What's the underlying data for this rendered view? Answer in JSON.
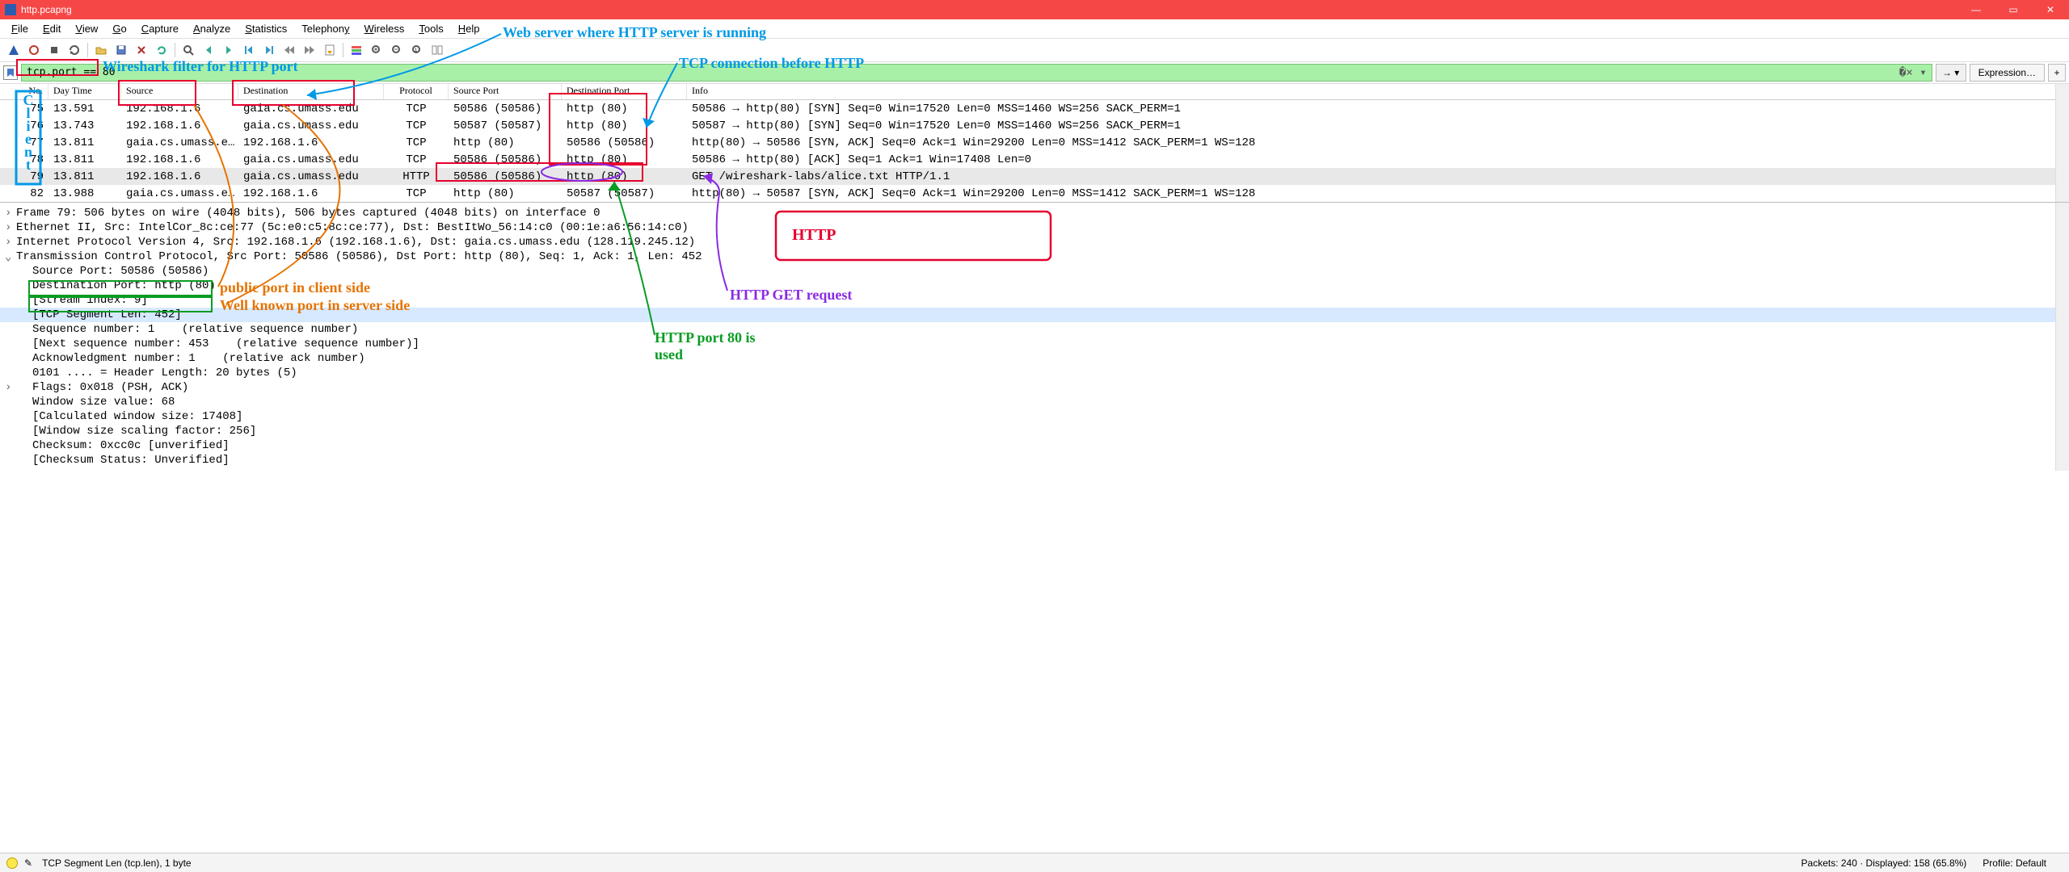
{
  "window": {
    "title": "http.pcapng"
  },
  "menus": [
    "File",
    "Edit",
    "View",
    "Go",
    "Capture",
    "Analyze",
    "Statistics",
    "Telephony",
    "Wireless",
    "Tools",
    "Help"
  ],
  "filter": {
    "value": "tcp.port == 80",
    "expression_label": "Expression…"
  },
  "columns": [
    "No.",
    "Day Time",
    "Source",
    "Destination",
    "Protocol",
    "Source Port",
    "Destination Port",
    "Info"
  ],
  "packets": [
    {
      "no": "75",
      "time": "13.591",
      "src": "192.168.1.6",
      "dst": "gaia.cs.umass.edu",
      "prot": "TCP",
      "sprt": "50586 (50586)",
      "dprt": "http (80)",
      "info": "50586 → http(80) [SYN] Seq=0 Win=17520 Len=0 MSS=1460 WS=256 SACK_PERM=1"
    },
    {
      "no": "76",
      "time": "13.743",
      "src": "192.168.1.6",
      "dst": "gaia.cs.umass.edu",
      "prot": "TCP",
      "sprt": "50587 (50587)",
      "dprt": "http (80)",
      "info": "50587 → http(80) [SYN] Seq=0 Win=17520 Len=0 MSS=1460 WS=256 SACK_PERM=1"
    },
    {
      "no": "77",
      "time": "13.811",
      "src": "gaia.cs.umass.e…",
      "dst": "192.168.1.6",
      "prot": "TCP",
      "sprt": "http (80)",
      "dprt": "50586 (50586)",
      "info": "http(80) → 50586 [SYN, ACK] Seq=0 Ack=1 Win=29200 Len=0 MSS=1412 SACK_PERM=1 WS=128"
    },
    {
      "no": "78",
      "time": "13.811",
      "src": "192.168.1.6",
      "dst": "gaia.cs.umass.edu",
      "prot": "TCP",
      "sprt": "50586 (50586)",
      "dprt": "http (80)",
      "info": "50586 → http(80) [ACK] Seq=1 Ack=1 Win=17408 Len=0"
    },
    {
      "no": "79",
      "time": "13.811",
      "src": "192.168.1.6",
      "dst": "gaia.cs.umass.edu",
      "prot": "HTTP",
      "sprt": "50586 (50586)",
      "dprt": "http (80)",
      "info": "GET /wireshark-labs/alice.txt HTTP/1.1",
      "sel": true
    },
    {
      "no": "82",
      "time": "13.988",
      "src": "gaia.cs.umass.e…",
      "dst": "192.168.1.6",
      "prot": "TCP",
      "sprt": "http (80)",
      "dprt": "50587 (50587)",
      "info": "http(80) → 50587 [SYN, ACK] Seq=0 Ack=1 Win=29200 Len=0 MSS=1412 SACK_PERM=1 WS=128"
    }
  ],
  "details": {
    "frame": "Frame 79: 506 bytes on wire (4048 bits), 506 bytes captured (4048 bits) on interface 0",
    "eth": "Ethernet II, Src: IntelCor_8c:ce:77 (5c:e0:c5:8c:ce:77), Dst: BestItWo_56:14:c0 (00:1e:a6:56:14:c0)",
    "ip": "Internet Protocol Version 4, Src: 192.168.1.6 (192.168.1.6), Dst: gaia.cs.umass.edu (128.119.245.12)",
    "tcp": "Transmission Control Protocol, Src Port: 50586 (50586), Dst Port: http (80), Seq: 1, Ack: 1, Len: 452",
    "srcport": "Source Port: 50586 (50586)",
    "dstport": "Destination Port: http (80)",
    "stream": "[Stream index: 9]",
    "seglen": "[TCP Segment Len: 452]",
    "seqnum": "Sequence number: 1    (relative sequence number)",
    "nextseq": "[Next sequence number: 453    (relative sequence number)]",
    "acknum": "Acknowledgment number: 1    (relative ack number)",
    "hdrlen": "0101 .... = Header Length: 20 bytes (5)",
    "flags": "Flags: 0x018 (PSH, ACK)",
    "winsize": "Window size value: 68",
    "calcwin": "[Calculated window size: 17408]",
    "winscale": "[Window size scaling factor: 256]",
    "cksum": "Checksum: 0xcc0c [unverified]",
    "ckstat": "[Checksum Status: Unverified]"
  },
  "status": {
    "field": "TCP Segment Len (tcp.len), 1 byte",
    "packets": "Packets: 240 · Displayed: 158 (65.8%)",
    "profile": "Profile: Default"
  },
  "annotations": {
    "client": "Client",
    "filter": "Wireshark filter for HTTP port",
    "webserver": "Web server where HTTP server is running",
    "tcpconn": "TCP connection before HTTP",
    "httpbox": "HTTP",
    "httpget": "HTTP GET request",
    "httpport": "HTTP port 80 is used",
    "pubport": "public port in client side",
    "wellknown": "Well known port in server side"
  }
}
